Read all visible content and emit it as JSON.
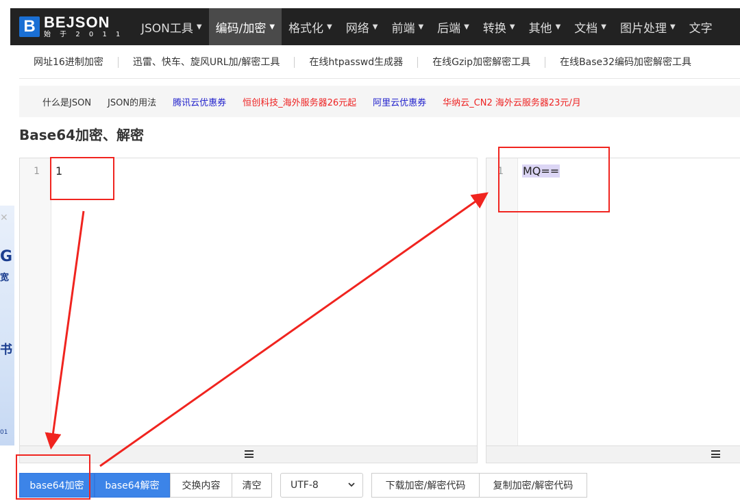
{
  "logo": {
    "mark": "B",
    "name": "BEJSON",
    "tagline": "始 于 2 0 1 1"
  },
  "nav": [
    {
      "label": "JSON工具",
      "active": false
    },
    {
      "label": "编码/加密",
      "active": true
    },
    {
      "label": "格式化",
      "active": false
    },
    {
      "label": "网络",
      "active": false
    },
    {
      "label": "前端",
      "active": false
    },
    {
      "label": "后端",
      "active": false
    },
    {
      "label": "转换",
      "active": false
    },
    {
      "label": "其他",
      "active": false
    },
    {
      "label": "文档",
      "active": false
    },
    {
      "label": "图片处理",
      "active": false
    },
    {
      "label": "文字",
      "active": false
    }
  ],
  "subtools": [
    "网址16进制加密",
    "迅雷、快车、旋风URL加/解密工具",
    "在线htpasswd生成器",
    "在线Gzip加密解密工具",
    "在线Base32编码加密解密工具"
  ],
  "links": [
    {
      "label": "什么是JSON",
      "color": "#333333"
    },
    {
      "label": "JSON的用法",
      "color": "#333333"
    },
    {
      "label": "腾讯云优惠券",
      "color": "#2222cc"
    },
    {
      "label": "恒创科技_海外服务器26元起",
      "color": "#ee2222"
    },
    {
      "label": "阿里云优惠券",
      "color": "#2222cc"
    },
    {
      "label": "华纳云_CN2 海外云服务器23元/月",
      "color": "#ee2222"
    }
  ],
  "page_title": "Base64加密、解密",
  "input_editor": {
    "line": "1",
    "content": "1"
  },
  "output_editor": {
    "line": "1",
    "content": "MQ=="
  },
  "ad": {
    "c1": "G",
    "c2": "宽",
    "c3": "",
    "c4": "书",
    "c5": "01"
  },
  "buttons": {
    "encode": "base64加密",
    "decode": "base64解密",
    "swap": "交换内容",
    "clear": "清空",
    "download": "下载加密/解密代码",
    "copy": "复制加密/解密代码"
  },
  "charset": {
    "selected": "UTF-8"
  },
  "colors": {
    "accent": "#3c84e8",
    "annotation": "#f0241f",
    "nav_bg": "#222222"
  }
}
